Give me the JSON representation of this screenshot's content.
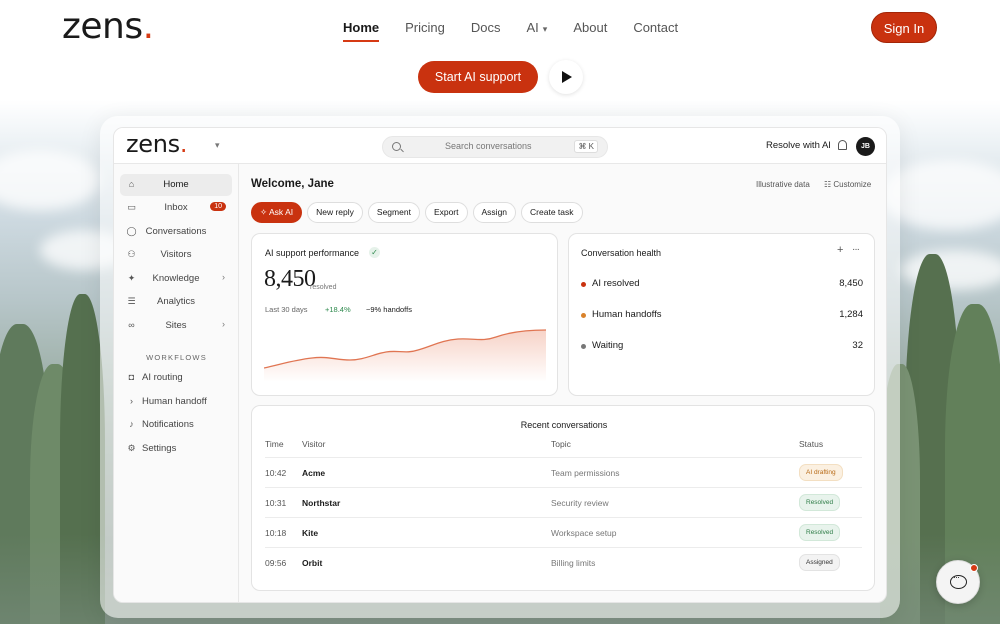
{
  "site": {
    "logo": "zens",
    "logo_dot": ".",
    "nav": [
      {
        "label": "Home",
        "active": true
      },
      {
        "label": "Pricing"
      },
      {
        "label": "Docs"
      },
      {
        "label": "AI",
        "dropdown": true
      },
      {
        "label": "About"
      },
      {
        "label": "Contact"
      }
    ],
    "signin_label": "Sign In",
    "cta_label": "Start AI support",
    "play_icon": "play-icon",
    "accent_color": "#c9320f"
  },
  "app": {
    "logo": "zens",
    "logo_dot": ".",
    "search": {
      "placeholder": "Search conversations",
      "shortcut": "⌘ K"
    },
    "resolve_label": "Resolve with AI",
    "avatar_initials": "JB",
    "sidebar": {
      "items": [
        {
          "label": "Home",
          "icon": "home-icon",
          "active": true
        },
        {
          "label": "Inbox",
          "icon": "inbox-icon",
          "badge": "10"
        },
        {
          "label": "Conversations",
          "icon": "chat-icon"
        },
        {
          "label": "Visitors",
          "icon": "users-icon"
        },
        {
          "label": "Knowledge",
          "icon": "sparkle-icon",
          "chevron": true
        },
        {
          "label": "Analytics",
          "icon": "sliders-icon"
        },
        {
          "label": "Sites",
          "icon": "link-icon",
          "chevron": true
        }
      ],
      "workflows_heading": "WORKFLOWS",
      "workflows": [
        {
          "label": "AI routing",
          "icon": "robot-icon"
        },
        {
          "label": "Human handoff",
          "icon": "chevron-right-icon"
        },
        {
          "label": "Notifications",
          "icon": "bell-icon"
        },
        {
          "label": "Settings",
          "icon": "gear-icon"
        }
      ]
    },
    "main": {
      "welcome": "Welcome, Jane",
      "illustrative": "Illustrative data",
      "customize": "Customize",
      "actions": [
        "Ask AI",
        "New reply",
        "Segment",
        "Export",
        "Assign",
        "Create task"
      ],
      "performance": {
        "title": "AI support performance",
        "value": "8,450",
        "unit": "resolved",
        "period": "Last 30 days",
        "delta": "+18.4%",
        "handoffs": "−9% handoffs"
      },
      "health": {
        "title": "Conversation health",
        "rows": [
          {
            "label": "AI resolved",
            "value": "8,450",
            "color": "#c9320f"
          },
          {
            "label": "Human handoffs",
            "value": "1,284",
            "color": "#d9822b"
          },
          {
            "label": "Waiting",
            "value": "32",
            "color": "#777777"
          }
        ]
      },
      "recent": {
        "title": "Recent conversations",
        "columns": [
          "Time",
          "Visitor",
          "Topic",
          "Status"
        ],
        "rows": [
          {
            "time": "10:42",
            "visitor": "Acme",
            "topic": "Team permissions",
            "status": "AI drafting"
          },
          {
            "time": "10:31",
            "visitor": "Northstar",
            "topic": "Security review",
            "status": "Resolved"
          },
          {
            "time": "10:18",
            "visitor": "Kite",
            "topic": "Workspace setup",
            "status": "Resolved"
          },
          {
            "time": "09:56",
            "visitor": "Orbit",
            "topic": "Billing limits",
            "status": "Assigned"
          }
        ]
      }
    }
  }
}
